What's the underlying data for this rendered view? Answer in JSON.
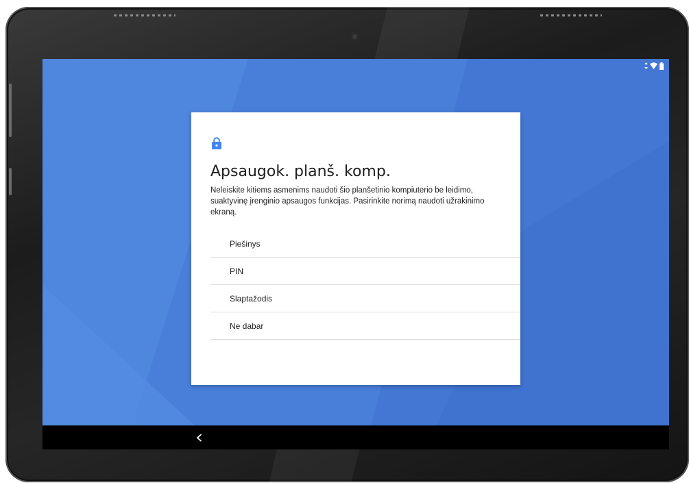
{
  "device": {
    "type": "tablet",
    "camera_icon": "camera-icon"
  },
  "status_bar": {
    "icons": [
      "data-arrows-icon",
      "wifi-icon",
      "battery-icon"
    ]
  },
  "dialog": {
    "icon": "lock-icon",
    "icon_color": "#4285f4",
    "title": "Apsaugok. planš. komp.",
    "description": "Neleiskite kitiems asmenims naudoti šio planšetinio kompiuterio be leidimo, suaktyvinę įrenginio apsaugos funkcijas. Pasirinkite norimą naudoti užrakinimo ekraną.",
    "options": [
      {
        "label": "Piešinys"
      },
      {
        "label": "PIN"
      },
      {
        "label": "Slaptažodis"
      },
      {
        "label": "Ne dabar"
      }
    ]
  },
  "navigation_bar": {
    "back_icon": "back-chevron-icon"
  },
  "colors": {
    "wallpaper": "#4a7fd9",
    "card_background": "#ffffff",
    "navbar": "#000000",
    "accent": "#4285f4"
  }
}
